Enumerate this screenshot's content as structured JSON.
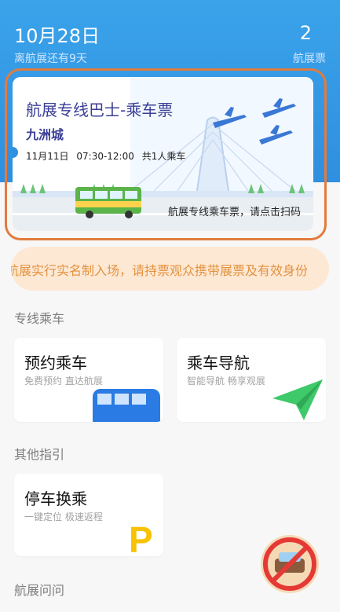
{
  "header": {
    "date": "10月28日",
    "countdown": "离航展还有9天",
    "ticket_count": "2",
    "ticket_label": "航展票"
  },
  "ticket": {
    "title": "航展专线巴士-乘车票",
    "destination": "九洲城",
    "date": "11月11日",
    "time": "07:30-12:00",
    "passengers": "共1人乘车",
    "scan_hint": "航展专线乘车票，请点击扫码"
  },
  "notice": "航展实行实名制入场，请持票观众携带展票及有效身份",
  "sections": [
    {
      "title": "专线乘车",
      "cards": [
        {
          "title": "预约乘车",
          "subtitle": "免费预约 直达航展",
          "icon": "bus-icon"
        },
        {
          "title": "乘车导航",
          "subtitle": "智能导航 畅享观展",
          "icon": "paper-plane-icon"
        }
      ]
    },
    {
      "title": "其他指引",
      "cards": [
        {
          "title": "停车换乘",
          "subtitle": "一键定位 极速返程",
          "icon": "parking-icon"
        }
      ]
    },
    {
      "title": "航展问问",
      "cards": []
    }
  ],
  "colors": {
    "hero_blue": "#2f8fe0",
    "highlight_orange": "#e27b3d",
    "notice_text": "#e4923e",
    "notice_bg": "#fde8d4",
    "parking_yellow": "#f7c200",
    "plane_green": "#3ec96a"
  },
  "fab_icon": "no-car-icon"
}
